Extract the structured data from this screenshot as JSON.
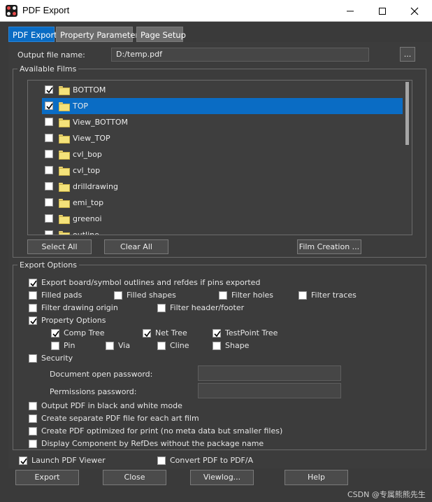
{
  "window": {
    "title": "PDF Export"
  },
  "tabs": [
    {
      "label": "PDF Export"
    },
    {
      "label": "Property Parameters"
    },
    {
      "label": "Page Setup"
    }
  ],
  "output": {
    "label": "Output file name:",
    "value": "D:/temp.pdf",
    "browse_label": "..."
  },
  "films": {
    "group_title": "Available Films",
    "items": [
      {
        "label": "BOTTOM",
        "checked": true
      },
      {
        "label": "TOP",
        "checked": true,
        "selected": true
      },
      {
        "label": "View_BOTTOM",
        "checked": false
      },
      {
        "label": "View_TOP",
        "checked": false
      },
      {
        "label": "cvl_bop",
        "checked": false
      },
      {
        "label": "cvl_top",
        "checked": false
      },
      {
        "label": "drilldrawing",
        "checked": false
      },
      {
        "label": "emi_top",
        "checked": false
      },
      {
        "label": "greenoi",
        "checked": false
      },
      {
        "label": "outline",
        "checked": false
      }
    ],
    "select_all": "Select All",
    "clear_all": "Clear All",
    "film_creation": "Film Creation ..."
  },
  "export_options": {
    "group_title": "Export Options",
    "export_outlines": {
      "label": "Export board/symbol outlines and refdes if pins exported",
      "checked": true
    },
    "filled_pads": {
      "label": "Filled pads",
      "checked": false
    },
    "filled_shapes": {
      "label": "Filled shapes",
      "checked": false
    },
    "filter_holes": {
      "label": "Filter holes",
      "checked": false
    },
    "filter_traces": {
      "label": "Filter traces",
      "checked": false
    },
    "filter_drawing_origin": {
      "label": "Filter drawing origin",
      "checked": false
    },
    "filter_header_footer": {
      "label": "Filter header/footer",
      "checked": false
    },
    "property_options": {
      "label": "Property Options",
      "checked": true
    },
    "comp_tree": {
      "label": "Comp Tree",
      "checked": true
    },
    "net_tree": {
      "label": "Net Tree",
      "checked": true
    },
    "testpoint_tree": {
      "label": "TestPoint Tree",
      "checked": true
    },
    "pin": {
      "label": "Pin",
      "checked": false
    },
    "via": {
      "label": "Via",
      "checked": false
    },
    "cline": {
      "label": "Cline",
      "checked": false
    },
    "shape": {
      "label": "Shape",
      "checked": false
    },
    "security": {
      "label": "Security",
      "checked": false
    },
    "doc_password": {
      "label": "Document open password:",
      "value": ""
    },
    "perm_password": {
      "label": "Permissions password:",
      "value": ""
    },
    "black_white": {
      "label": "Output PDF in black and white mode",
      "checked": false
    },
    "separate_pdf": {
      "label": "Create separate PDF file for each art film",
      "checked": false
    },
    "optimized": {
      "label": "Create PDF optimized for print (no meta data but smaller files)",
      "checked": false
    },
    "display_refdes": {
      "label": "Display Component by RefDes without the package name",
      "checked": false
    }
  },
  "launch_viewer": {
    "label": "Launch PDF Viewer",
    "checked": true
  },
  "convert_pdfa": {
    "label": "Convert PDF to PDF/A",
    "checked": false
  },
  "buttons": {
    "export": "Export",
    "close": "Close",
    "viewlog": "Viewlog...",
    "help": "Help"
  },
  "watermark": "CSDN @专属熊熊先生"
}
